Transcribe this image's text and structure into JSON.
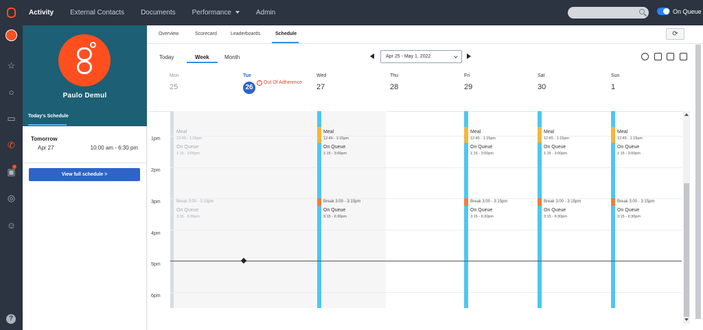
{
  "nav": {
    "items": [
      "Activity",
      "External Contacts",
      "Documents",
      "Performance",
      "Admin"
    ],
    "status_label": "On Queue"
  },
  "profile": {
    "name": "Paulo Demul",
    "tab_label": "Today's Schedule",
    "next_label": "Tomorrow",
    "next_date": "Apr 27",
    "next_time": "10:00 am - 6:30 pm",
    "button_label": "View full schedule >"
  },
  "subtabs": [
    "Overview",
    "Scorecard",
    "Leaderboards",
    "Schedule"
  ],
  "view": {
    "options": [
      "Today",
      "Week",
      "Month"
    ],
    "date_range": "Apr 25 - May 1, 2022"
  },
  "days": [
    {
      "name": "Mon",
      "num": "25"
    },
    {
      "name": "Tue",
      "num": "26"
    },
    {
      "name": "Wed",
      "num": "27"
    },
    {
      "name": "Thu",
      "num": "28"
    },
    {
      "name": "Fri",
      "num": "29"
    },
    {
      "name": "Sat",
      "num": "30"
    },
    {
      "name": "Sun",
      "num": "1"
    }
  ],
  "adherence_label": "Out Of Adherence",
  "hours": [
    "1pm",
    "2pm",
    "3pm",
    "4pm",
    "5pm",
    "6pm"
  ],
  "blocks": {
    "meal": "Meal",
    "meal_time": "12:45 - 1:15pm",
    "onqueue": "On Queue",
    "onqueue_time1": "1:15 - 3:00pm",
    "break_label": "Break  3:00 - 3:15pm",
    "onqueue_time2": "3:15 - 6:30pm"
  },
  "colors": {
    "nav_bg": "#2b3440",
    "accent": "#2f63c7",
    "on_queue": "#4fc6f0",
    "meal": "#f4b63b",
    "break": "#f07e3b",
    "adherence": "#e0442f"
  }
}
